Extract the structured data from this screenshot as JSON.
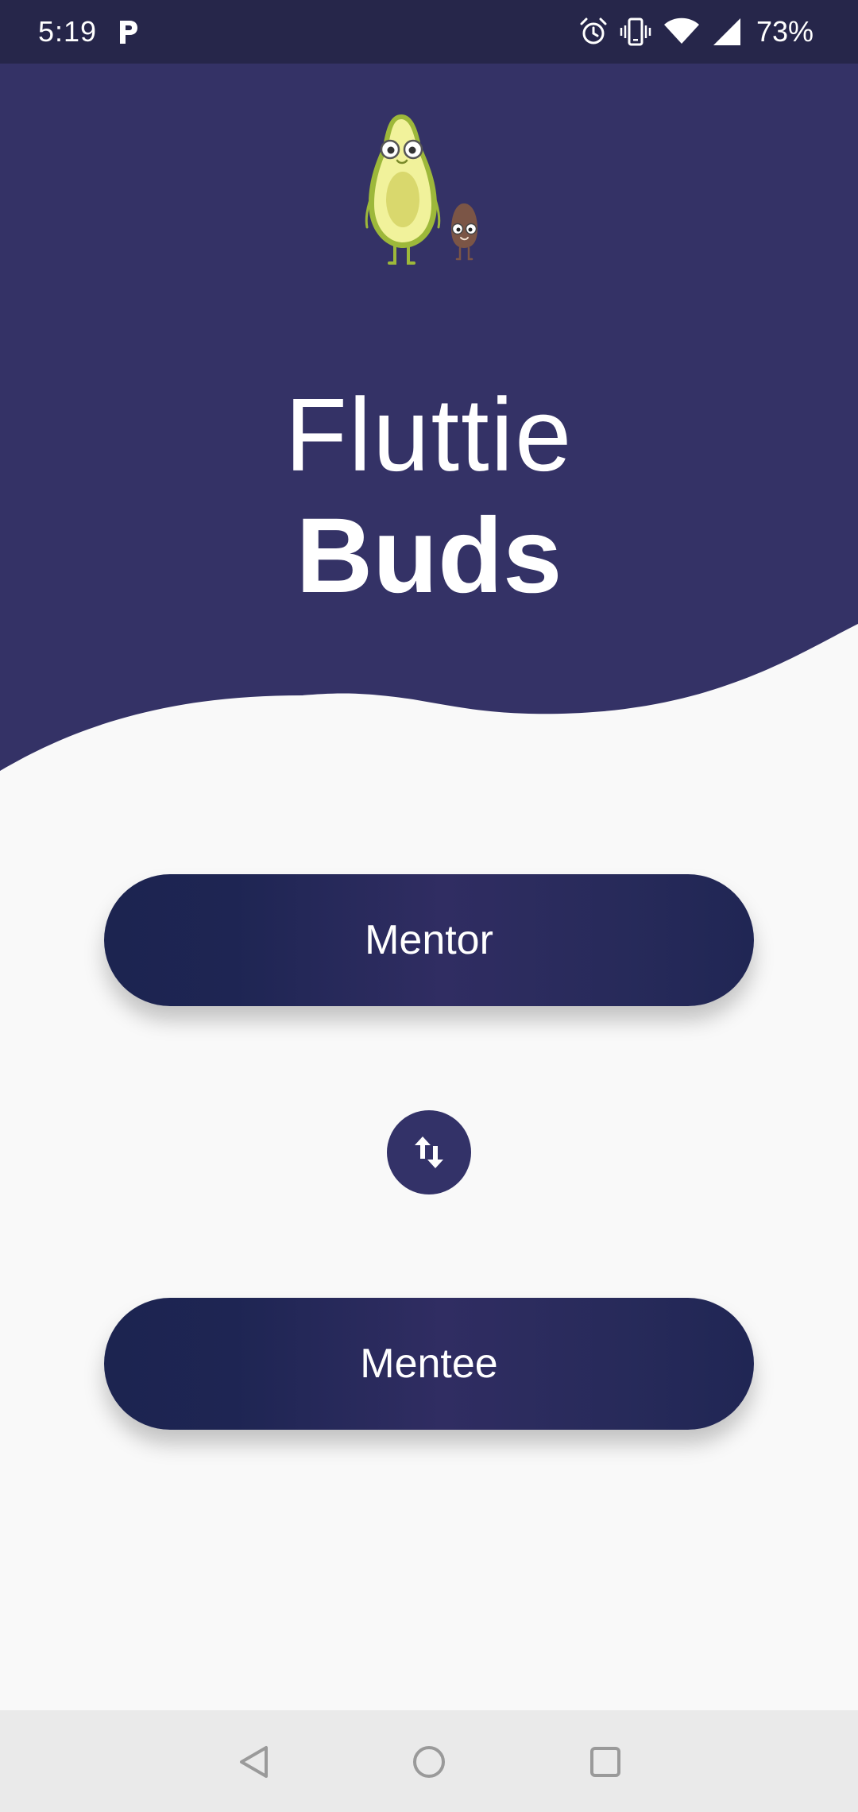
{
  "status_bar": {
    "time": "5:19",
    "battery": "73%",
    "icons": [
      "parking-icon",
      "alarm-icon",
      "vibrate-icon",
      "wifi-icon",
      "signal-icon"
    ]
  },
  "app": {
    "title_light": "Fluttie",
    "title_bold": "Buds",
    "header_color": "#343266",
    "background_color": "#f9f9f9"
  },
  "buttons": {
    "mentor_label": "Mentor",
    "mentee_label": "Mentee",
    "swap_icon": "swap-vertical-icon"
  },
  "nav_bar": {
    "icons": [
      "back-icon",
      "home-icon",
      "recents-icon"
    ]
  }
}
